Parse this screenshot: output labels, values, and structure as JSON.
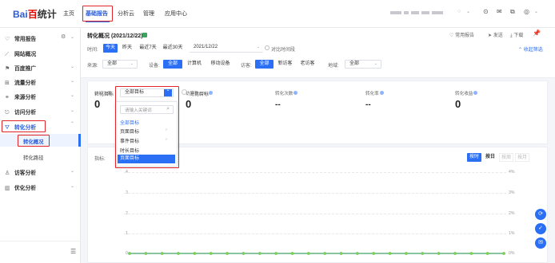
{
  "logo": {
    "brand": "Bai",
    "paw": "百",
    "suffix": "统计"
  },
  "topnav": {
    "items": [
      "主页",
      "基础报告",
      "分析云",
      "管理",
      "应用中心"
    ],
    "active": "基础报告",
    "right_icons": [
      "chevron-down-icon",
      "question-icon",
      "mail-icon",
      "copy-icon",
      "user-icon"
    ]
  },
  "sidebar": {
    "groups": [
      {
        "label": "常用报告",
        "icon": "heart-icon",
        "extra": "gear-icon"
      },
      {
        "label": "网站概况",
        "icon": "trend-icon"
      },
      {
        "label": "百度推广",
        "icon": "flag-icon"
      },
      {
        "label": "流量分析",
        "icon": "grid-icon"
      },
      {
        "label": "来源分析",
        "icon": "share-icon"
      },
      {
        "label": "访问分析",
        "icon": "exit-icon"
      },
      {
        "label": "转化分析",
        "icon": "funnel-icon",
        "active": true
      },
      {
        "label": "访客分析",
        "icon": "person-icon"
      },
      {
        "label": "优化分析",
        "icon": "bar-icon"
      }
    ],
    "sub_items": [
      "转化概况",
      "转化路径"
    ],
    "active_sub": "转化概况",
    "collapse_icon": "menu-icon"
  },
  "header": {
    "title": "转化概况 (2021/12/22)",
    "date_label": "时间:",
    "date_tabs": [
      "今天",
      "昨天",
      "最近7天",
      "最近30天"
    ],
    "active_date_tab": "今天",
    "date_value": "2021/12/22",
    "compare_label": "对比时间段",
    "source_label": "来源:",
    "source_value": "全部",
    "device_label": "设备:",
    "device_tabs": [
      "全部",
      "计算机",
      "移动设备"
    ],
    "active_device": "全部",
    "visitor_label": "访客:",
    "visitor_tabs": [
      "全部",
      "新访客",
      "老访客"
    ],
    "active_visitor": "全部",
    "region_label": "地域:",
    "region_value": "全部",
    "actions": [
      "常用报告",
      "发送",
      "下载"
    ],
    "collapse_filter": "收起筛选"
  },
  "goal": {
    "label": "转化目标",
    "select_value": "全部目标",
    "compare_label": "对比目标",
    "search_placeholder": "请输入关键词",
    "options": [
      "全部目标",
      "页面目标",
      "事件目标",
      "时长目标",
      "页面目标"
    ],
    "selected_index": 4
  },
  "stats": [
    {
      "title": "访问次数",
      "value": "0"
    },
    {
      "title": "访客数(UV)",
      "value": "0"
    },
    {
      "title": "转化次数",
      "value": "--"
    },
    {
      "title": "转化率",
      "value": "--"
    },
    {
      "title": "转化收益",
      "value": "0"
    }
  ],
  "chart": {
    "metric_label": "指标:",
    "granularity": [
      "按时",
      "按日",
      "按周",
      "按月"
    ],
    "active_granularity": "按时",
    "disabled_granularity": [
      "按周",
      "按月"
    ]
  },
  "chart_data": {
    "type": "line",
    "ylabels_left": [
      "4",
      "3",
      "2",
      "1",
      "0"
    ],
    "ylabels_right": [
      "4%",
      "3%",
      "2%",
      "1%",
      "0%"
    ],
    "ylim": [
      0,
      4
    ],
    "series": [
      {
        "values": [
          0,
          0,
          0,
          0,
          0,
          0,
          0,
          0,
          0,
          0,
          0,
          0,
          0,
          0,
          0,
          0,
          0,
          0,
          0,
          0,
          0,
          0,
          0,
          0
        ]
      },
      {
        "values": [
          0,
          0,
          0,
          0,
          0,
          0,
          0,
          0,
          0,
          0,
          0,
          0,
          0,
          0,
          0,
          0,
          0,
          0,
          0,
          0,
          0,
          0,
          0,
          0
        ]
      }
    ],
    "grid": true,
    "colors": [
      "#2b6ff5",
      "#7dd44b"
    ]
  },
  "colors": {
    "accent": "#2b6ff5",
    "highlight": "#e1252b"
  }
}
